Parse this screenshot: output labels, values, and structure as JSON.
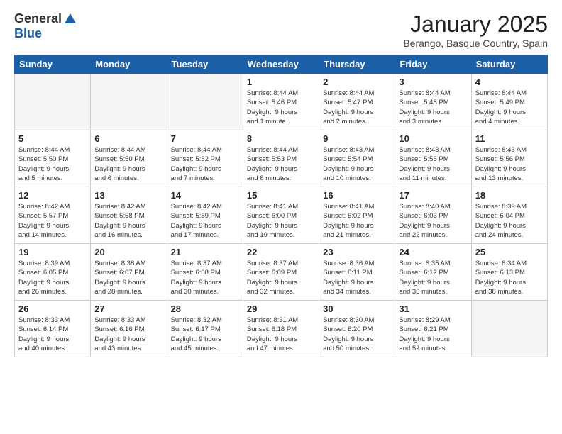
{
  "logo": {
    "general": "General",
    "blue": "Blue"
  },
  "header": {
    "title": "January 2025",
    "subtitle": "Berango, Basque Country, Spain"
  },
  "days_of_week": [
    "Sunday",
    "Monday",
    "Tuesday",
    "Wednesday",
    "Thursday",
    "Friday",
    "Saturday"
  ],
  "weeks": [
    [
      {
        "day": "",
        "info": ""
      },
      {
        "day": "",
        "info": ""
      },
      {
        "day": "",
        "info": ""
      },
      {
        "day": "1",
        "info": "Sunrise: 8:44 AM\nSunset: 5:46 PM\nDaylight: 9 hours\nand 1 minute."
      },
      {
        "day": "2",
        "info": "Sunrise: 8:44 AM\nSunset: 5:47 PM\nDaylight: 9 hours\nand 2 minutes."
      },
      {
        "day": "3",
        "info": "Sunrise: 8:44 AM\nSunset: 5:48 PM\nDaylight: 9 hours\nand 3 minutes."
      },
      {
        "day": "4",
        "info": "Sunrise: 8:44 AM\nSunset: 5:49 PM\nDaylight: 9 hours\nand 4 minutes."
      }
    ],
    [
      {
        "day": "5",
        "info": "Sunrise: 8:44 AM\nSunset: 5:50 PM\nDaylight: 9 hours\nand 5 minutes."
      },
      {
        "day": "6",
        "info": "Sunrise: 8:44 AM\nSunset: 5:50 PM\nDaylight: 9 hours\nand 6 minutes."
      },
      {
        "day": "7",
        "info": "Sunrise: 8:44 AM\nSunset: 5:52 PM\nDaylight: 9 hours\nand 7 minutes."
      },
      {
        "day": "8",
        "info": "Sunrise: 8:44 AM\nSunset: 5:53 PM\nDaylight: 9 hours\nand 8 minutes."
      },
      {
        "day": "9",
        "info": "Sunrise: 8:43 AM\nSunset: 5:54 PM\nDaylight: 9 hours\nand 10 minutes."
      },
      {
        "day": "10",
        "info": "Sunrise: 8:43 AM\nSunset: 5:55 PM\nDaylight: 9 hours\nand 11 minutes."
      },
      {
        "day": "11",
        "info": "Sunrise: 8:43 AM\nSunset: 5:56 PM\nDaylight: 9 hours\nand 13 minutes."
      }
    ],
    [
      {
        "day": "12",
        "info": "Sunrise: 8:42 AM\nSunset: 5:57 PM\nDaylight: 9 hours\nand 14 minutes."
      },
      {
        "day": "13",
        "info": "Sunrise: 8:42 AM\nSunset: 5:58 PM\nDaylight: 9 hours\nand 16 minutes."
      },
      {
        "day": "14",
        "info": "Sunrise: 8:42 AM\nSunset: 5:59 PM\nDaylight: 9 hours\nand 17 minutes."
      },
      {
        "day": "15",
        "info": "Sunrise: 8:41 AM\nSunset: 6:00 PM\nDaylight: 9 hours\nand 19 minutes."
      },
      {
        "day": "16",
        "info": "Sunrise: 8:41 AM\nSunset: 6:02 PM\nDaylight: 9 hours\nand 21 minutes."
      },
      {
        "day": "17",
        "info": "Sunrise: 8:40 AM\nSunset: 6:03 PM\nDaylight: 9 hours\nand 22 minutes."
      },
      {
        "day": "18",
        "info": "Sunrise: 8:39 AM\nSunset: 6:04 PM\nDaylight: 9 hours\nand 24 minutes."
      }
    ],
    [
      {
        "day": "19",
        "info": "Sunrise: 8:39 AM\nSunset: 6:05 PM\nDaylight: 9 hours\nand 26 minutes."
      },
      {
        "day": "20",
        "info": "Sunrise: 8:38 AM\nSunset: 6:07 PM\nDaylight: 9 hours\nand 28 minutes."
      },
      {
        "day": "21",
        "info": "Sunrise: 8:37 AM\nSunset: 6:08 PM\nDaylight: 9 hours\nand 30 minutes."
      },
      {
        "day": "22",
        "info": "Sunrise: 8:37 AM\nSunset: 6:09 PM\nDaylight: 9 hours\nand 32 minutes."
      },
      {
        "day": "23",
        "info": "Sunrise: 8:36 AM\nSunset: 6:11 PM\nDaylight: 9 hours\nand 34 minutes."
      },
      {
        "day": "24",
        "info": "Sunrise: 8:35 AM\nSunset: 6:12 PM\nDaylight: 9 hours\nand 36 minutes."
      },
      {
        "day": "25",
        "info": "Sunrise: 8:34 AM\nSunset: 6:13 PM\nDaylight: 9 hours\nand 38 minutes."
      }
    ],
    [
      {
        "day": "26",
        "info": "Sunrise: 8:33 AM\nSunset: 6:14 PM\nDaylight: 9 hours\nand 40 minutes."
      },
      {
        "day": "27",
        "info": "Sunrise: 8:33 AM\nSunset: 6:16 PM\nDaylight: 9 hours\nand 43 minutes."
      },
      {
        "day": "28",
        "info": "Sunrise: 8:32 AM\nSunset: 6:17 PM\nDaylight: 9 hours\nand 45 minutes."
      },
      {
        "day": "29",
        "info": "Sunrise: 8:31 AM\nSunset: 6:18 PM\nDaylight: 9 hours\nand 47 minutes."
      },
      {
        "day": "30",
        "info": "Sunrise: 8:30 AM\nSunset: 6:20 PM\nDaylight: 9 hours\nand 50 minutes."
      },
      {
        "day": "31",
        "info": "Sunrise: 8:29 AM\nSunset: 6:21 PM\nDaylight: 9 hours\nand 52 minutes."
      },
      {
        "day": "",
        "info": ""
      }
    ]
  ]
}
